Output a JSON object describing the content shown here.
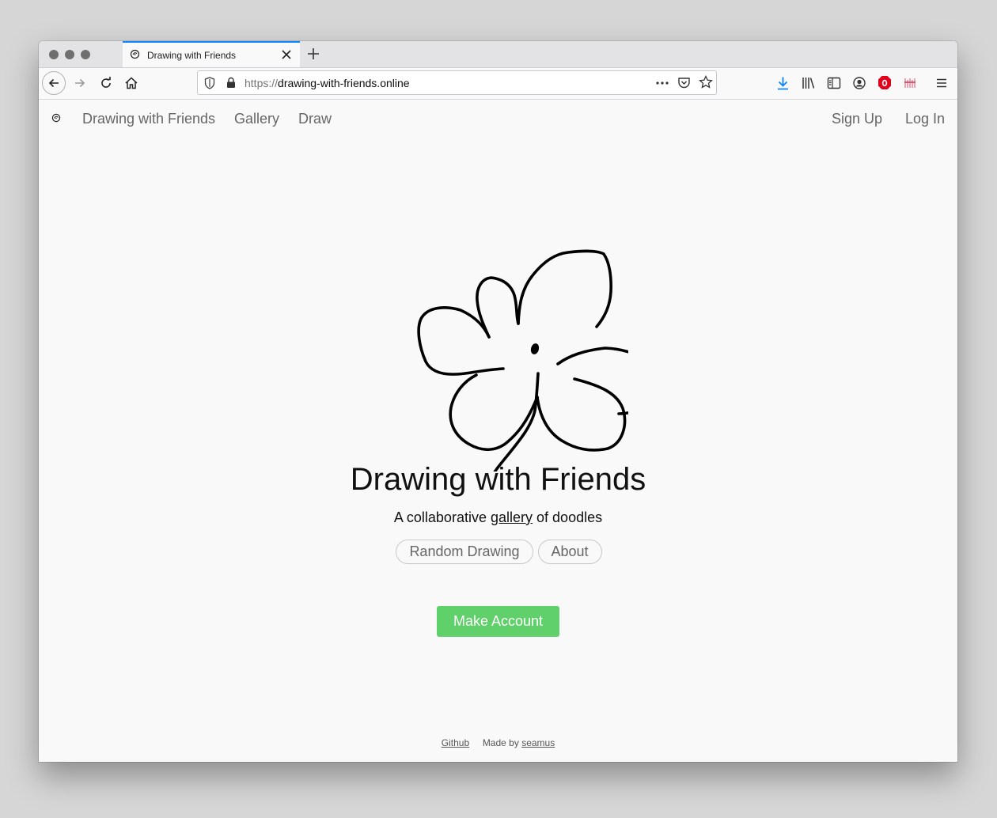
{
  "browser": {
    "tab_title": "Drawing with Friends",
    "url_scheme": "https://",
    "url_host": "drawing-with-friends.online",
    "icons": [
      "back-icon",
      "forward-icon",
      "reload-icon",
      "home-icon",
      "shield-icon",
      "lock-icon",
      "more-icon",
      "pocket-icon",
      "bookmark-star-icon",
      "download-icon",
      "library-icon",
      "sidebar-icon",
      "account-icon",
      "adblock-icon",
      "extension-icon",
      "menu-icon"
    ]
  },
  "site_nav": {
    "brand": "Drawing with Friends",
    "gallery": "Gallery",
    "draw": "Draw",
    "sign_up": "Sign Up",
    "log_in": "Log In"
  },
  "hero": {
    "title": "Drawing with Friends",
    "tagline_before": "A collaborative",
    "tagline_link": "gallery",
    "tagline_after": "of doodles",
    "random_button": "Random Drawing",
    "about_button": "About",
    "cta_button": "Make Account"
  },
  "footer": {
    "github": "Github",
    "made_by": "Made by",
    "author": "seamus"
  },
  "colors": {
    "accent_tab": "#0a84ff",
    "cta": "#5fd06a",
    "download_icon": "#0a84ff",
    "adblock_icon": "#e3001b"
  }
}
